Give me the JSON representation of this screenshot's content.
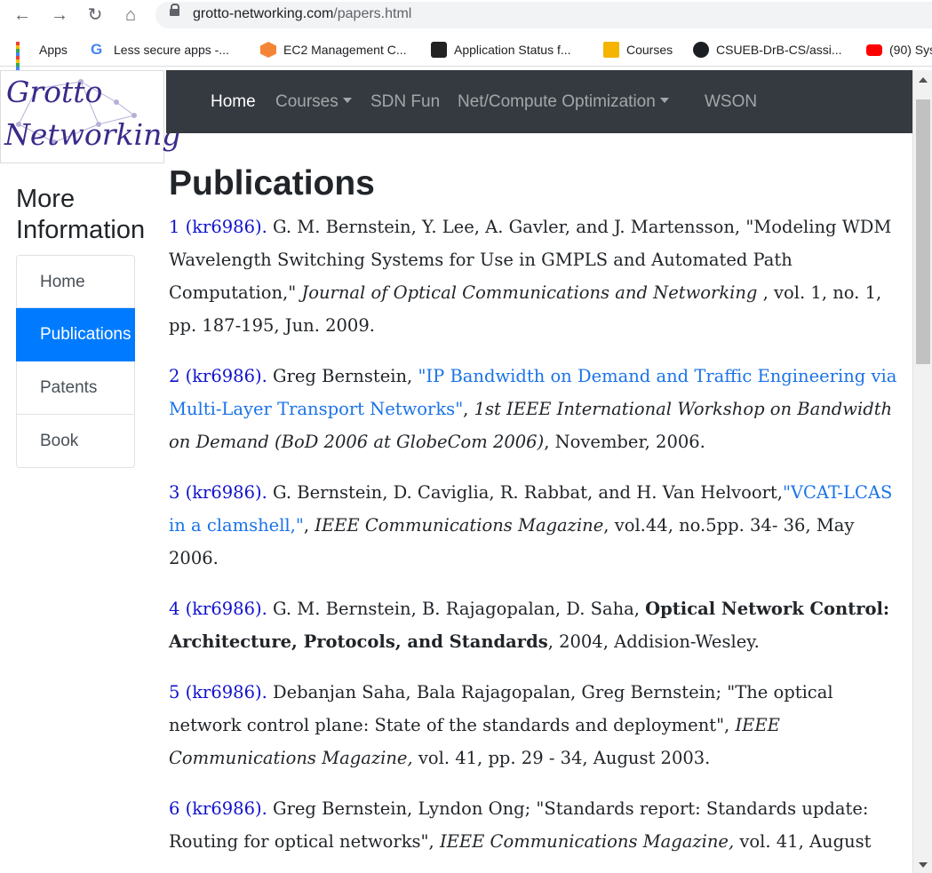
{
  "browser": {
    "url_host": "grotto-networking.com",
    "url_path": "/papers.html",
    "bookmarks": [
      {
        "label": "Apps"
      },
      {
        "label": "Less secure apps -..."
      },
      {
        "label": "EC2 Management C..."
      },
      {
        "label": "Application Status f..."
      },
      {
        "label": "Courses"
      },
      {
        "label": "CSUEB-DrB-CS/assi..."
      },
      {
        "label": "(90) Sys"
      }
    ]
  },
  "logo": {
    "line1": "Grotto",
    "line2": "Networking"
  },
  "navbar": {
    "home": "Home",
    "courses": "Courses",
    "sdn": "SDN Fun",
    "optimization": "Net/Compute Optimization",
    "wson": "WSON"
  },
  "sidebar": {
    "title_line1": "More",
    "title_line2": "Information",
    "items": [
      {
        "label": "Home"
      },
      {
        "label": "Publications"
      },
      {
        "label": "Patents"
      },
      {
        "label": "Book"
      }
    ]
  },
  "main": {
    "title": "Publications",
    "pubs": [
      {
        "num": "1 (kr6986).",
        "text": " G. M. Bernstein, Y. Lee, A. Gavler, and J. Martensson, \"Modeling WDM Wavelength Switching Systems for Use in GMPLS and Automated Path Computation,\" ",
        "journal": "Journal of Optical Communications and Networking",
        "tail": " , vol. 1, no. 1, pp. 187-195, Jun. 2009."
      },
      {
        "num": "2 (kr6986).",
        "text": " Greg Bernstein, ",
        "link": "\"IP Bandwidth on Demand and Traffic Engineering via Multi-Layer Transport Networks\"",
        "text2": ", ",
        "journal": "1st IEEE International Workshop on Bandwidth on Demand (BoD 2006 at GlobeCom 2006)",
        "tail": ", November, 2006."
      },
      {
        "num": "3 (kr6986).",
        "text": " G. Bernstein, D. Caviglia, R. Rabbat, and H. Van Helvoort,",
        "link": "\"VCAT-LCAS in a clamshell,\"",
        "text2": ", ",
        "journal": "IEEE Communications Magazine",
        "tail": ", vol.44, no.5pp. 34- 36, May 2006."
      },
      {
        "num": "4 (kr6986).",
        "text": " G. M. Bernstein, B. Rajagopalan, D. Saha, ",
        "bold": "Optical Network Control: Architecture, Protocols, and Standards",
        "tail": ", 2004, Addision-Wesley."
      },
      {
        "num": "5 (kr6986).",
        "text": " Debanjan Saha, Bala Rajagopalan, Greg Bernstein; \"The optical network control plane: State of the standards and deployment\", ",
        "journal": "IEEE Communications Magazine,",
        "tail": " vol. 41, pp. 29 - 34, August 2003."
      },
      {
        "num": "6 (kr6986).",
        "text": " Greg Bernstein, Lyndon Ong; \"Standards report: Standards update: Routing for optical networks\", ",
        "journal": "IEEE Communications Magazine,",
        "tail": " vol. 41, August"
      }
    ]
  },
  "colors": {
    "navbar_bg": "#343a40",
    "active_item": "#007bff",
    "number_link": "#1111cc",
    "title_link": "#1a73e8"
  }
}
